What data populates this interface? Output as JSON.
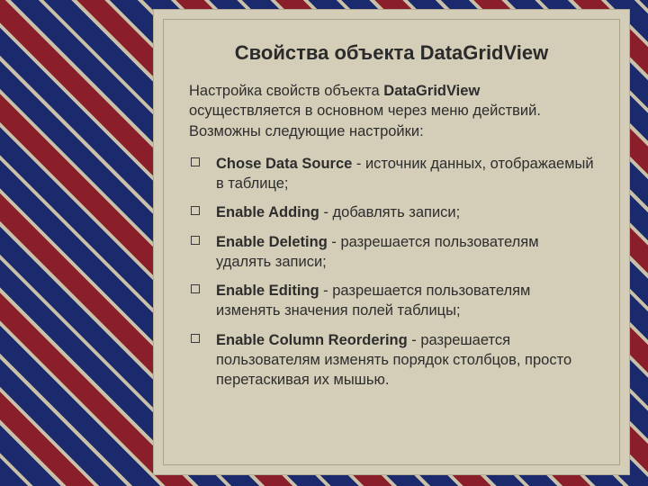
{
  "title": "Свойства объекта DataGridView",
  "intro_prefix": "Настройка свойств объекта ",
  "intro_bold": "DataGridView",
  "intro_suffix": " осуществляется в основном через меню действий. Возможны следующие настройки:",
  "items": [
    {
      "term": "Chose Data Source",
      "desc": " - источник данных, отображаемый в таблице;"
    },
    {
      "term": "Enable Adding",
      "desc": " - добавлять записи;"
    },
    {
      "term": "Enable Deleting",
      "desc": " - разрешается пользователям удалять записи;"
    },
    {
      "term": "Enable Editing",
      "desc": " - разрешается пользователям изменять значения полей таблицы;"
    },
    {
      "term": "Enable Column Reordering",
      "desc": " - разрешается пользователям изменять порядок столбцов, просто перетаскивая их мышью."
    }
  ]
}
